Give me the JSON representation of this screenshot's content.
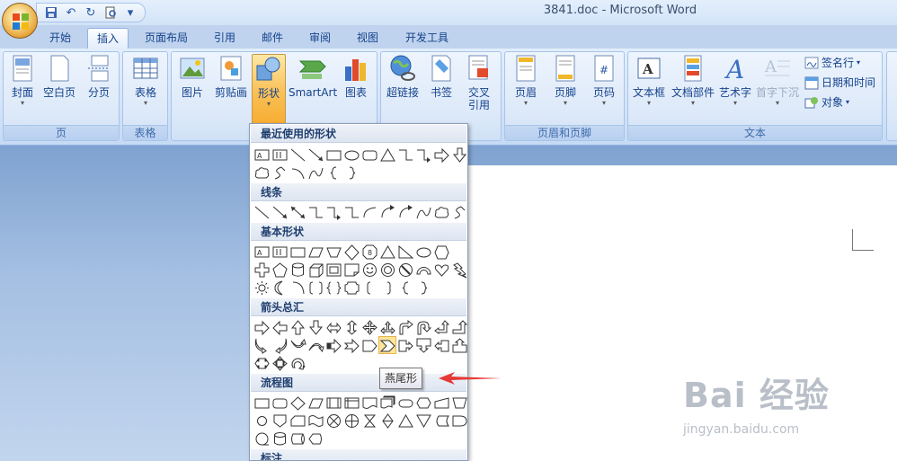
{
  "window": {
    "title": "3841.doc - Microsoft Word"
  },
  "tabs": [
    "开始",
    "插入",
    "页面布局",
    "引用",
    "邮件",
    "审阅",
    "视图",
    "开发工具"
  ],
  "ribbon": {
    "groups": {
      "pages": {
        "label": "页",
        "buttons": [
          "封面",
          "空白页",
          "分页"
        ]
      },
      "tables": {
        "label": "表格",
        "buttons": [
          "表格"
        ]
      },
      "illustrations": {
        "buttons": [
          "图片",
          "剪贴画",
          "形状",
          "SmartArt",
          "图表"
        ]
      },
      "links": {
        "buttons": [
          "超链接",
          "书签",
          "交叉",
          "引用"
        ]
      },
      "header_footer": {
        "label": "页眉和页脚",
        "buttons": [
          "页眉",
          "页脚",
          "页码"
        ]
      },
      "text": {
        "label": "文本",
        "buttons": [
          "文本框",
          "文档部件",
          "艺术字",
          "首字下沉"
        ],
        "small": [
          "签名行",
          "日期和时间",
          "对象"
        ]
      }
    }
  },
  "gallery": {
    "sections": [
      "最近使用的形状",
      "线条",
      "基本形状",
      "箭头总汇",
      "流程图",
      "标注"
    ],
    "tooltip": "燕尾形"
  },
  "watermark": {
    "main": "Bai 经验",
    "url": "jingyan.baidu.com"
  },
  "colors": {
    "accent": "#f7ad32",
    "ribbon_text": "#15428b",
    "arrow": "#e53935"
  }
}
